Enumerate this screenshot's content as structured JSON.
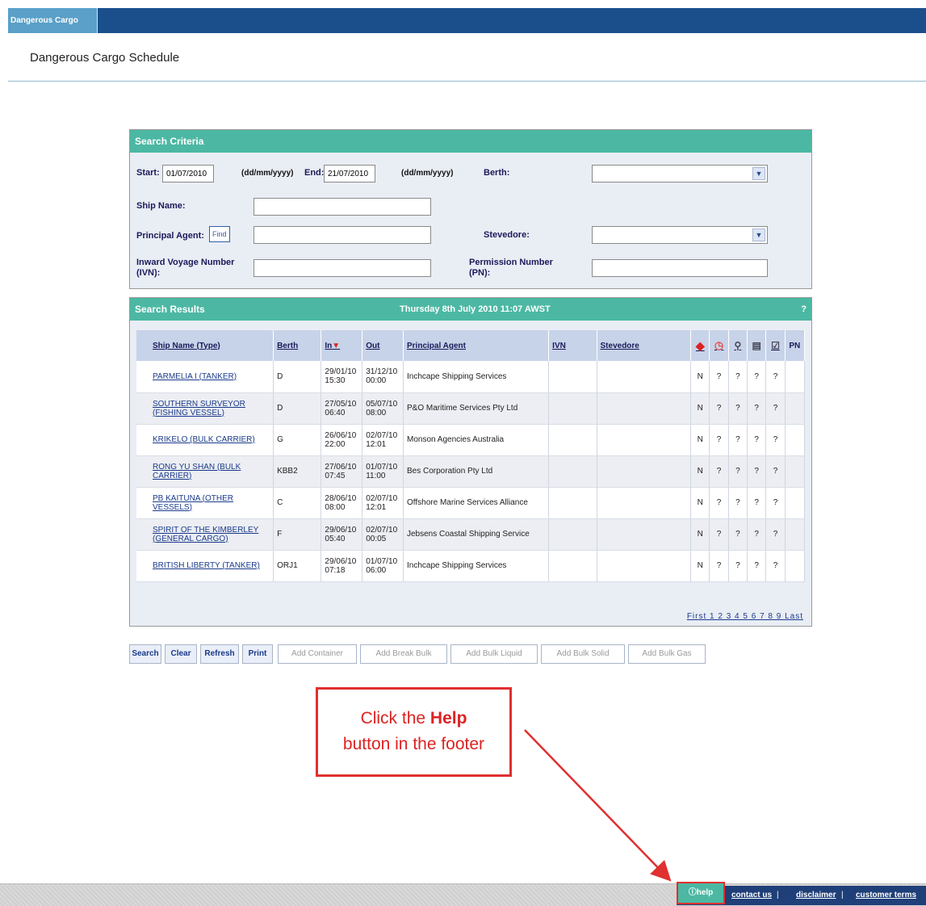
{
  "app": {
    "tab_label": "Dangerous Cargo",
    "page_title": "Dangerous Cargo Schedule"
  },
  "search_criteria": {
    "header": "Search Criteria",
    "start_label": "Start:",
    "start_value": "01/07/2010",
    "start_note": "(dd/mm/yyyy)",
    "end_label": "End:",
    "end_value": "21/07/2010",
    "end_note": "(dd/mm/yyyy)",
    "berth_label": "Berth:",
    "ship_name_label": "Ship Name:",
    "principal_agent_label": "Principal Agent:",
    "find_label": "Find",
    "stevedore_label": "Stevedore:",
    "ivn_label": "Inward Voyage Number (IVN):",
    "pn_label": "Permission Number (PN):"
  },
  "search_results": {
    "header": "Search Results",
    "date": "Thursday 8th July 2010 11:07 AWST",
    "corner": "?",
    "columns": {
      "ship": "Ship Name (Type)",
      "berth": "Berth",
      "in": "In",
      "out": "Out",
      "agent": "Principal Agent",
      "ivn": "IVN",
      "stevedore": "Stevedore",
      "pn": "PN"
    },
    "rows": [
      {
        "ship": "PARMELIA I (TANKER)",
        "berth": "D",
        "in": "29/01/10 15:30",
        "out": "31/12/10 00:00",
        "agent": "Inchcape Shipping Services",
        "ivn": "",
        "stevedore": "",
        "c1": "N",
        "c2": "?",
        "c3": "?",
        "c4": "?",
        "c5": "?"
      },
      {
        "ship": "SOUTHERN SURVEYOR (FISHING VESSEL)",
        "berth": "D",
        "in": "27/05/10 06:40",
        "out": "05/07/10 08:00",
        "agent": "P&O Maritime Services Pty Ltd",
        "ivn": "",
        "stevedore": "",
        "c1": "N",
        "c2": "?",
        "c3": "?",
        "c4": "?",
        "c5": "?"
      },
      {
        "ship": "KRIKELO (BULK CARRIER)",
        "berth": "G",
        "in": "26/06/10 22:00",
        "out": "02/07/10 12:01",
        "agent": "Monson Agencies Australia",
        "ivn": "",
        "stevedore": "",
        "c1": "N",
        "c2": "?",
        "c3": "?",
        "c4": "?",
        "c5": "?"
      },
      {
        "ship": "RONG YU SHAN (BULK CARRIER)",
        "berth": "KBB2",
        "in": "27/06/10 07:45",
        "out": "01/07/10 11:00",
        "agent": "Bes Corporation Pty Ltd",
        "ivn": "",
        "stevedore": "",
        "c1": "N",
        "c2": "?",
        "c3": "?",
        "c4": "?",
        "c5": "?"
      },
      {
        "ship": "PB KAITUNA (OTHER VESSELS)",
        "berth": "C",
        "in": "28/06/10 08:00",
        "out": "02/07/10 12:01",
        "agent": "Offshore Marine Services Alliance",
        "ivn": "",
        "stevedore": "",
        "c1": "N",
        "c2": "?",
        "c3": "?",
        "c4": "?",
        "c5": "?"
      },
      {
        "ship": "SPIRIT OF THE KIMBERLEY (GENERAL CARGO)",
        "berth": "F",
        "in": "29/06/10 05:40",
        "out": "02/07/10 00:05",
        "agent": "Jebsens Coastal Shipping Service",
        "ivn": "",
        "stevedore": "",
        "c1": "N",
        "c2": "?",
        "c3": "?",
        "c4": "?",
        "c5": "?"
      },
      {
        "ship": "BRITISH LIBERTY (TANKER)",
        "berth": "ORJ1",
        "in": "29/06/10 07:18",
        "out": "01/07/10 06:00",
        "agent": "Inchcape Shipping Services",
        "ivn": "",
        "stevedore": "",
        "c1": "N",
        "c2": "?",
        "c3": "?",
        "c4": "?",
        "c5": "?"
      }
    ],
    "pager": "First 1 2 3 4 5 6 7 8 9 Last"
  },
  "buttons": {
    "search": "Search",
    "clear": "Clear",
    "refresh": "Refresh",
    "print": "Print",
    "add_container": "Add Container",
    "add_break_bulk": "Add Break Bulk",
    "add_bulk_liquid": "Add Bulk Liquid",
    "add_bulk_solid": "Add Bulk Solid",
    "add_bulk_gas": "Add Bulk Gas"
  },
  "callout": {
    "line1_prefix": "Click the ",
    "line1_bold": "Help",
    "line2": "button in the footer"
  },
  "footer": {
    "help": "help",
    "contact": "contact us",
    "disclaimer": "disclaimer",
    "customer_terms": "customer terms",
    "separator": "|"
  },
  "colors": {
    "topbar": "#1b4f8c",
    "panel_header": "#4cb8a3",
    "callout": "#e03030"
  },
  "icons": [
    "diamond-red-icon",
    "clock-red-icon",
    "pin-icon",
    "document-icon",
    "checkbox-icon"
  ]
}
